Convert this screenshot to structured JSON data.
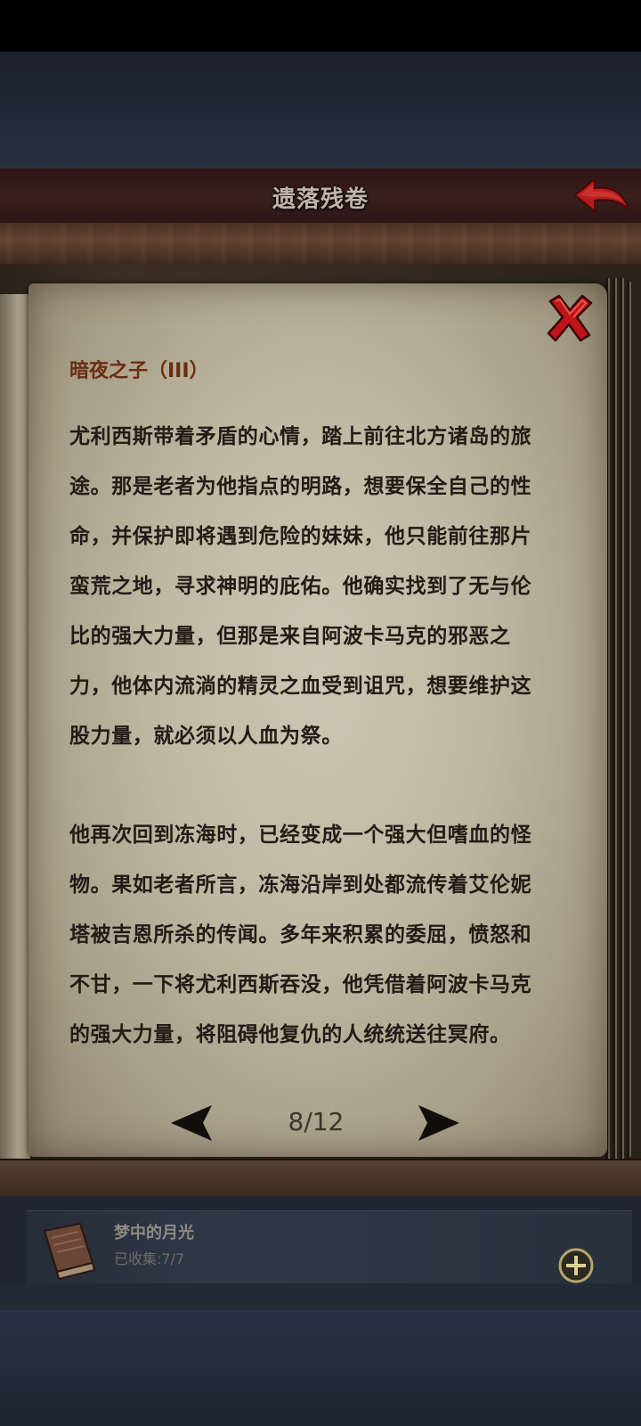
{
  "header": {
    "title": "遗落残卷"
  },
  "page": {
    "chapter_title": "暗夜之子（III）",
    "paragraphs": [
      "尤利西斯带着矛盾的心情，踏上前往北方诸岛的旅途。那是老者为他指点的明路，想要保全自己的性命，并保护即将遇到危险的妹妹，他只能前往那片蛮荒之地，寻求神明的庇佑。他确实找到了无与伦比的强大力量，但那是来自阿波卡马克的邪恶之力，他体内流淌的精灵之血受到诅咒，想要维护这股力量，就必须以人血为祭。",
      "他再次回到冻海时，已经变成一个强大但嗜血的怪物。果如老者所言，冻海沿岸到处都流传着艾伦妮塔被吉恩所杀的传闻。多年来积累的委屈，愤怒和不甘，一下将尤利西斯吞没，他凭借着阿波卡马克的强大力量，将阻碍他复仇的人统统送往冥府。"
    ],
    "pagination": "8/12"
  },
  "collection": {
    "name": "梦中的月光",
    "status": "已收集:7/7"
  },
  "icons": {
    "back": "back-arrow-icon",
    "close": "close-x-icon",
    "prev": "prev-page-icon",
    "next": "next-page-icon",
    "book": "book-icon",
    "plus": "plus-circle-icon"
  },
  "colors": {
    "accent_red": "#c0141a",
    "chapter_title": "#6a2d12",
    "parchment": "#c4bda7"
  }
}
